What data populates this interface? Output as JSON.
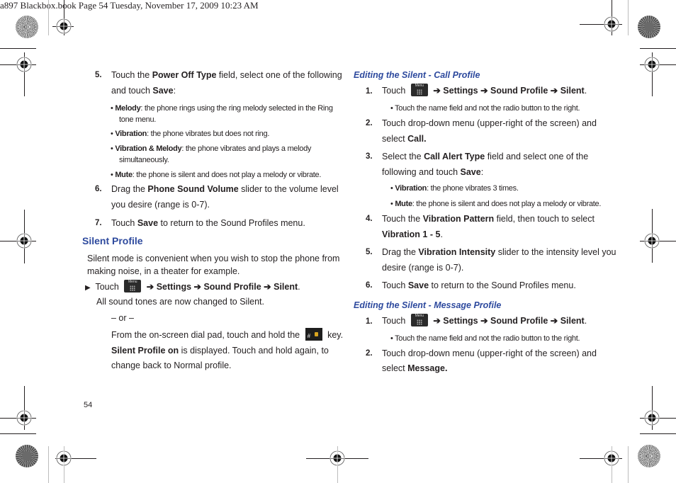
{
  "slug_line": "a897 Blackbox.book  Page 54  Tuesday, November 17, 2009  10:23 AM",
  "page_number": "54",
  "colors": {
    "heading": "#2e4a9e",
    "text": "#231f20"
  },
  "left": {
    "steps_top": [
      {
        "num": "5.",
        "parts": [
          [
            "Touch the ",
            ""
          ],
          [
            "Power Off Type",
            "b"
          ],
          [
            " field, select one of the following",
            ""
          ]
        ],
        "line2": [
          [
            "and touch ",
            ""
          ],
          [
            "Save",
            "b"
          ],
          [
            ":",
            ""
          ]
        ],
        "bullets": [
          {
            "l1": [
              [
                "Melody",
                "b"
              ],
              [
                ": the phone rings using the ring melody selected in the Ring",
                ""
              ]
            ],
            "l2": "tone menu."
          },
          {
            "l1": [
              [
                "Vibration",
                "b"
              ],
              [
                ": the phone vibrates but does not ring.",
                ""
              ]
            ]
          },
          {
            "l1": [
              [
                "Vibration & Melody",
                "b"
              ],
              [
                ": the phone vibrates and plays a melody",
                ""
              ]
            ],
            "l2": "simultaneously."
          },
          {
            "l1": [
              [
                "Mute",
                "b"
              ],
              [
                ": the phone is silent and does not play a melody or vibrate.",
                ""
              ]
            ]
          }
        ]
      },
      {
        "num": "6.",
        "parts": [
          [
            "Drag the ",
            ""
          ],
          [
            "Phone Sound Volume",
            "b"
          ],
          [
            " slider to the volume level",
            ""
          ]
        ],
        "line2": [
          [
            "you desire (range is 0-7).",
            ""
          ]
        ]
      },
      {
        "num": "7.",
        "parts": [
          [
            "Touch ",
            ""
          ],
          [
            "Save",
            "b"
          ],
          [
            " to return to the Sound Profiles menu.",
            ""
          ]
        ]
      }
    ],
    "section_title": "Silent Profile",
    "intro_l1": "Silent mode is convenient when you wish to stop the phone from",
    "intro_l2": "making noise, in a theater for example.",
    "touch_label": "Touch",
    "menu_key_label": "Menu",
    "path": [
      [
        "Settings",
        "b"
      ],
      [
        "Sound Profile",
        "b"
      ],
      [
        "Silent",
        "b"
      ]
    ],
    "arrow": "➔",
    "result": "All sound tones are now changed to Silent.",
    "or": "– or –",
    "alt_l1_pre": "From the on-screen dial pad, touch and hold the",
    "alt_l1_post": "key.",
    "hash_key_label": "#",
    "alt_l2_bold": "Silent Profile on",
    "alt_l2_rest": " is displayed. Touch and hold again, to",
    "alt_l3": "change back to Normal profile."
  },
  "right": {
    "call_title": "Editing the Silent - Call Profile",
    "call_steps": {
      "s1_num": "1.",
      "s1_touch": "Touch",
      "s1_note": "Touch the name field and not the radio button to the right.",
      "s2_num": "2.",
      "s2_l1": "Touch drop-down menu (upper-right of the screen) and",
      "s2_l2_pre": "select ",
      "s2_l2_bold": "Call.",
      "s3_num": "3.",
      "s3_l1": [
        [
          "Select the ",
          ""
        ],
        [
          "Call Alert Type",
          "b"
        ],
        [
          " field and select one of the",
          ""
        ]
      ],
      "s3_l2": [
        [
          "following and touch ",
          ""
        ],
        [
          "Save",
          "b"
        ],
        [
          ":",
          ""
        ]
      ],
      "s3_b1": [
        [
          "Vibration",
          "b"
        ],
        [
          ": the phone vibrates 3 times.",
          ""
        ]
      ],
      "s3_b2": [
        [
          "Mute",
          "b"
        ],
        [
          ": the phone is silent and does not play a melody or vibrate.",
          ""
        ]
      ],
      "s4_num": "4.",
      "s4_l1": [
        [
          "Touch the ",
          ""
        ],
        [
          "Vibration Pattern",
          "b"
        ],
        [
          " field, then touch to select",
          ""
        ]
      ],
      "s4_l2": [
        [
          "Vibration 1 - 5",
          "b"
        ],
        [
          ".",
          ""
        ]
      ],
      "s5_num": "5.",
      "s5_l1": [
        [
          "Drag the ",
          ""
        ],
        [
          "Vibration Intensity",
          "b"
        ],
        [
          " slider to the intensity level you",
          ""
        ]
      ],
      "s5_l2": "desire (range is 0-7).",
      "s6_num": "6.",
      "s6_l1": [
        [
          "Touch ",
          ""
        ],
        [
          "Save",
          "b"
        ],
        [
          " to return to the Sound Profiles menu.",
          ""
        ]
      ]
    },
    "msg_title": "Editing the Silent - Message Profile",
    "msg_steps": {
      "s1_num": "1.",
      "s1_touch": "Touch",
      "s1_note": "Touch the name field and not the radio button to the right.",
      "s2_num": "2.",
      "s2_l1": "Touch drop-down menu (upper-right of the screen) and",
      "s2_l2_pre": "select ",
      "s2_l2_bold": "Message."
    }
  }
}
